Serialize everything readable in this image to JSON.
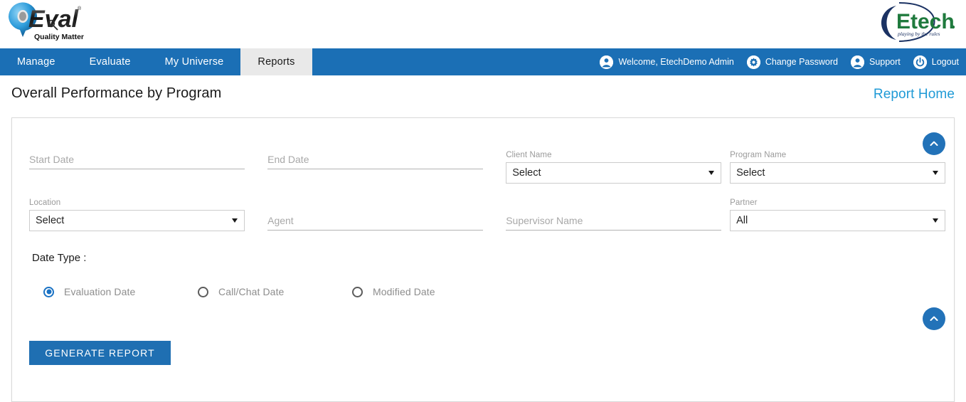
{
  "brand": {
    "qeval_name": "QEval",
    "qeval_tagline": "Quality Matters",
    "etech_name": "Etech",
    "etech_tagline": "playing by the rules"
  },
  "colors": {
    "nav_blue": "#1b6fb5",
    "active_tab_bg": "#e9e9e9",
    "link_blue": "#1f9ad6",
    "button_blue": "#1f6fb2",
    "radio_blue": "#1a72c4"
  },
  "nav": {
    "items": [
      {
        "label": "Manage",
        "active": false
      },
      {
        "label": "Evaluate",
        "active": false
      },
      {
        "label": "My Universe",
        "active": false
      },
      {
        "label": "Reports",
        "active": true
      }
    ],
    "utilities": [
      {
        "label": "Welcome, EtechDemo Admin",
        "icon": "user-icon"
      },
      {
        "label": "Change Password",
        "icon": "gear-icon"
      },
      {
        "label": "Support",
        "icon": "user-icon"
      },
      {
        "label": "Logout",
        "icon": "power-icon"
      }
    ]
  },
  "header": {
    "title": "Overall Performance by Program",
    "report_home_link": "Report Home"
  },
  "form": {
    "start_date": {
      "label": "Start Date",
      "placeholder": "Start Date",
      "value": ""
    },
    "end_date": {
      "label": "End Date",
      "placeholder": "End Date",
      "value": ""
    },
    "client_name": {
      "label": "Client Name",
      "value": "Select"
    },
    "program_name": {
      "label": "Program Name",
      "value": "Select"
    },
    "location": {
      "label": "Location",
      "value": "Select"
    },
    "agent": {
      "label": "Agent",
      "placeholder": "Agent",
      "value": ""
    },
    "supervisor_name": {
      "label": "Supervisor Name",
      "placeholder": "Supervisor Name",
      "value": ""
    },
    "partner": {
      "label": "Partner",
      "value": "All"
    },
    "date_type": {
      "label": "Date Type :",
      "options": [
        {
          "label": "Evaluation Date",
          "selected": true
        },
        {
          "label": "Call/Chat Date",
          "selected": false
        },
        {
          "label": "Modified Date",
          "selected": false
        }
      ]
    },
    "generate_button": "GENERATE REPORT"
  }
}
